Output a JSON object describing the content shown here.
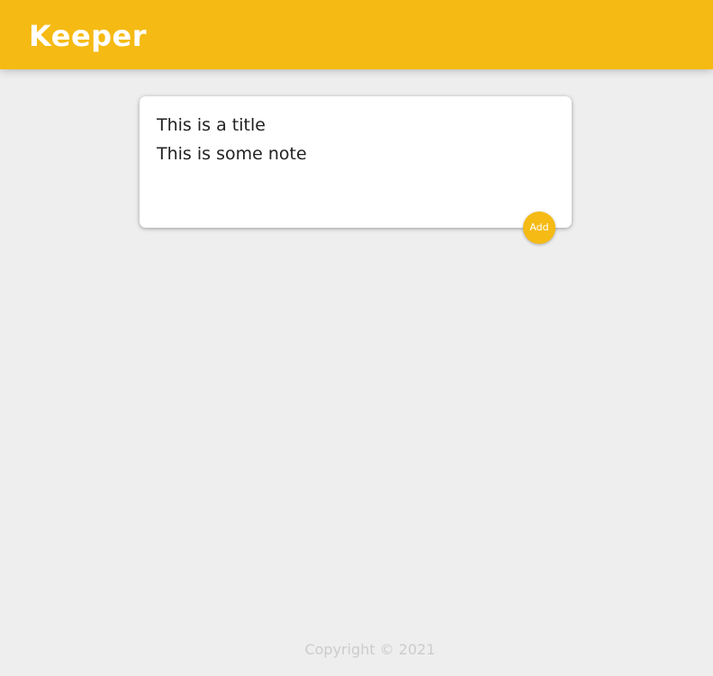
{
  "header": {
    "brand": "Keeper"
  },
  "note_form": {
    "title_value": "This is a title",
    "content_value": "This is some note",
    "add_label": "Add"
  },
  "footer": {
    "copyright": "Copyright © 2021"
  },
  "colors": {
    "accent": "#f5ba13",
    "background": "#eeeeee",
    "card": "#ffffff",
    "footer_text": "#cccccc"
  }
}
